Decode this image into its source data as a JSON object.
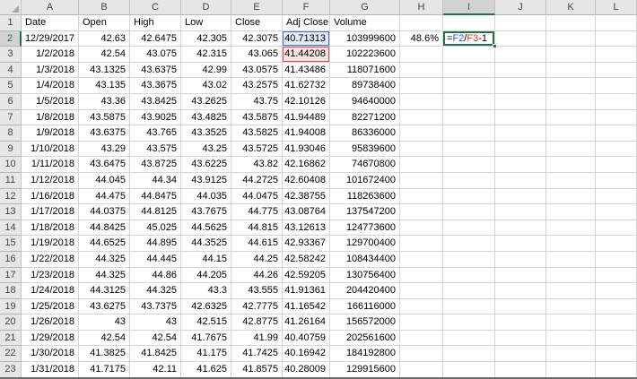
{
  "sheet": {
    "column_letters": [
      "A",
      "B",
      "C",
      "D",
      "E",
      "F",
      "G",
      "H",
      "I",
      "J",
      "K",
      "L"
    ],
    "row_numbers": [
      "1",
      "2",
      "3",
      "4",
      "5",
      "6",
      "7",
      "8",
      "9",
      "10",
      "11",
      "12",
      "13",
      "14",
      "15",
      "16",
      "17",
      "18",
      "19",
      "20",
      "21",
      "22",
      "23"
    ],
    "header_row": [
      "Date",
      "Open",
      "High",
      "Low",
      "Close",
      "Adj Close",
      "Volume"
    ],
    "rows": [
      {
        "date": "12/29/2017",
        "open": "42.63",
        "high": "42.6475",
        "low": "42.305",
        "close": "42.3075",
        "adj_close": "40.71313",
        "volume": "103999600"
      },
      {
        "date": "1/2/2018",
        "open": "42.54",
        "high": "43.075",
        "low": "42.315",
        "close": "43.065",
        "adj_close": "41.44208",
        "volume": "102223600"
      },
      {
        "date": "1/3/2018",
        "open": "43.1325",
        "high": "43.6375",
        "low": "42.99",
        "close": "43.0575",
        "adj_close": "41.43486",
        "volume": "118071600"
      },
      {
        "date": "1/4/2018",
        "open": "43.135",
        "high": "43.3675",
        "low": "43.02",
        "close": "43.2575",
        "adj_close": "41.62732",
        "volume": "89738400"
      },
      {
        "date": "1/5/2018",
        "open": "43.36",
        "high": "43.8425",
        "low": "43.2625",
        "close": "43.75",
        "adj_close": "42.10126",
        "volume": "94640000"
      },
      {
        "date": "1/8/2018",
        "open": "43.5875",
        "high": "43.9025",
        "low": "43.4825",
        "close": "43.5875",
        "adj_close": "41.94489",
        "volume": "82271200"
      },
      {
        "date": "1/9/2018",
        "open": "43.6375",
        "high": "43.765",
        "low": "43.3525",
        "close": "43.5825",
        "adj_close": "41.94008",
        "volume": "86336000"
      },
      {
        "date": "1/10/2018",
        "open": "43.29",
        "high": "43.575",
        "low": "43.25",
        "close": "43.5725",
        "adj_close": "41.93046",
        "volume": "95839600"
      },
      {
        "date": "1/11/2018",
        "open": "43.6475",
        "high": "43.8725",
        "low": "43.6225",
        "close": "43.82",
        "adj_close": "42.16862",
        "volume": "74670800"
      },
      {
        "date": "1/12/2018",
        "open": "44.045",
        "high": "44.34",
        "low": "43.9125",
        "close": "44.2725",
        "adj_close": "42.60408",
        "volume": "101672400"
      },
      {
        "date": "1/16/2018",
        "open": "44.475",
        "high": "44.8475",
        "low": "44.035",
        "close": "44.0475",
        "adj_close": "42.38755",
        "volume": "118263600"
      },
      {
        "date": "1/17/2018",
        "open": "44.0375",
        "high": "44.8125",
        "low": "43.7675",
        "close": "44.775",
        "adj_close": "43.08764",
        "volume": "137547200"
      },
      {
        "date": "1/18/2018",
        "open": "44.8425",
        "high": "45.025",
        "low": "44.5625",
        "close": "44.815",
        "adj_close": "43.12613",
        "volume": "124773600"
      },
      {
        "date": "1/19/2018",
        "open": "44.6525",
        "high": "44.895",
        "low": "44.3525",
        "close": "44.615",
        "adj_close": "42.93367",
        "volume": "129700400"
      },
      {
        "date": "1/22/2018",
        "open": "44.325",
        "high": "44.445",
        "low": "44.15",
        "close": "44.25",
        "adj_close": "42.58242",
        "volume": "108434400"
      },
      {
        "date": "1/23/2018",
        "open": "44.325",
        "high": "44.86",
        "low": "44.205",
        "close": "44.26",
        "adj_close": "42.59205",
        "volume": "130756400"
      },
      {
        "date": "1/24/2018",
        "open": "44.3125",
        "high": "44.325",
        "low": "43.3",
        "close": "43.555",
        "adj_close": "41.91361",
        "volume": "204420400"
      },
      {
        "date": "1/25/2018",
        "open": "43.6275",
        "high": "43.7375",
        "low": "42.6325",
        "close": "42.7775",
        "adj_close": "41.16542",
        "volume": "166116000"
      },
      {
        "date": "1/26/2018",
        "open": "43",
        "high": "43",
        "low": "42.515",
        "close": "42.8775",
        "adj_close": "41.26164",
        "volume": "156572000"
      },
      {
        "date": "1/29/2018",
        "open": "42.54",
        "high": "42.54",
        "low": "41.7675",
        "close": "41.99",
        "adj_close": "40.40759",
        "volume": "202561600"
      },
      {
        "date": "1/30/2018",
        "open": "41.3825",
        "high": "41.8425",
        "low": "41.175",
        "close": "41.7425",
        "adj_close": "40.16942",
        "volume": "184192800"
      },
      {
        "date": "1/31/2018",
        "open": "41.7175",
        "high": "42.11",
        "low": "41.625",
        "close": "41.8575",
        "adj_close": "40.28009",
        "volume": "129915600"
      }
    ],
    "h2_percent": "48.6%",
    "formula": {
      "cell": "I2",
      "text": "=F2/F3-1",
      "parts": [
        {
          "text": "=",
          "color": "black"
        },
        {
          "text": "F2",
          "color": "blue"
        },
        {
          "text": "/",
          "color": "black"
        },
        {
          "text": "F3",
          "color": "red"
        },
        {
          "text": "-1",
          "color": "black"
        }
      ]
    },
    "selection": {
      "active_cell": "I2",
      "highlighted_column": "I",
      "highlighted_row": "2",
      "reference_blue_cell": "F2",
      "reference_red_cell": "F3"
    },
    "colors": {
      "selection_green": "#217346",
      "reference_blue": "#4472c4",
      "reference_blue_fill": "#e1ebf9",
      "reference_red": "#cf5050",
      "reference_red_fill": "#f7e3e3",
      "header_bg": "#e6e6e6",
      "header_selected_bg": "#d2d2d2",
      "gridline": "#d6d6d6"
    }
  }
}
